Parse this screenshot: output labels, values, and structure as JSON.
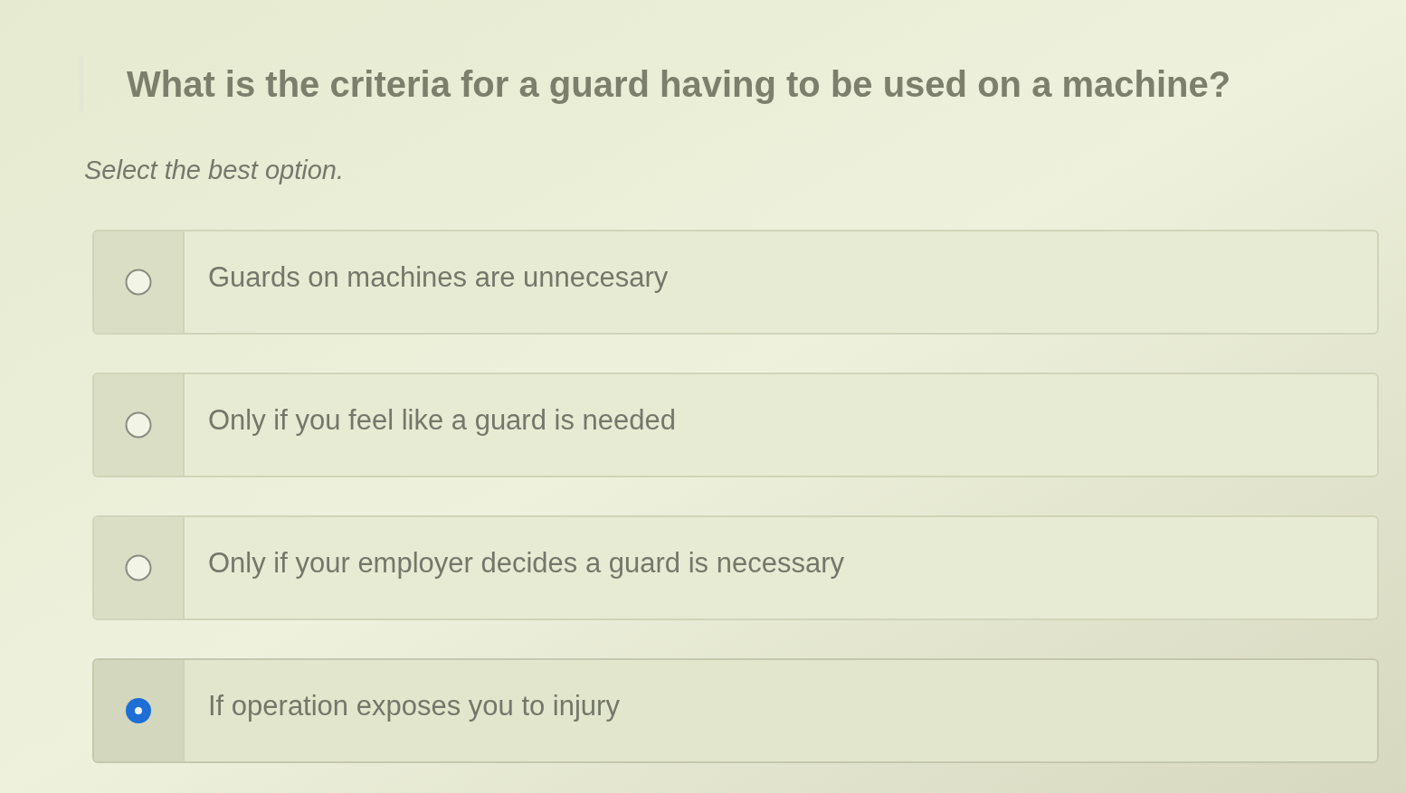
{
  "question": {
    "title": "What is the criteria for a guard having to be used on a machine?",
    "instruction": "Select the best option."
  },
  "options": [
    {
      "label": "Guards on machines are unnecesary",
      "selected": false
    },
    {
      "label": "Only if you feel like a guard is needed",
      "selected": false
    },
    {
      "label": "Only if your employer decides a guard is necessary",
      "selected": false
    },
    {
      "label": "If operation exposes you to injury",
      "selected": true
    }
  ]
}
